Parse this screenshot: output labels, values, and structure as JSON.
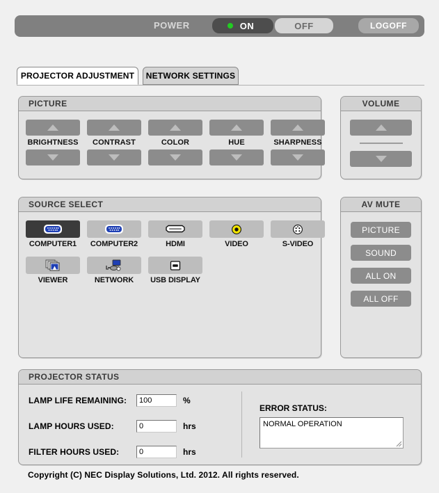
{
  "power": {
    "label": "POWER",
    "on_label": "ON",
    "off_label": "OFF",
    "logoff_label": "LOGOFF",
    "state": "ON",
    "led_color": "#22cc22",
    "on_bg": "#4d4d4d",
    "bar_bg": "#808080"
  },
  "tabs": [
    {
      "label": "PROJECTOR ADJUSTMENT",
      "active": true
    },
    {
      "label": "NETWORK SETTINGS",
      "active": false
    }
  ],
  "picture": {
    "title": "PICTURE",
    "items": [
      {
        "label": "BRIGHTNESS"
      },
      {
        "label": "CONTRAST"
      },
      {
        "label": "COLOR"
      },
      {
        "label": "HUE"
      },
      {
        "label": "SHARPNESS"
      }
    ]
  },
  "volume": {
    "title": "VOLUME"
  },
  "source_select": {
    "title": "SOURCE SELECT",
    "row1": [
      {
        "label": "COMPUTER1",
        "icon": "vga-port-icon",
        "selected": true
      },
      {
        "label": "COMPUTER2",
        "icon": "vga-port-icon",
        "selected": false
      },
      {
        "label": "HDMI",
        "icon": "hdmi-port-icon",
        "selected": false
      },
      {
        "label": "VIDEO",
        "icon": "rca-composite-icon",
        "selected": false
      },
      {
        "label": "S-VIDEO",
        "icon": "svideo-port-icon",
        "selected": false
      }
    ],
    "row2": [
      {
        "label": "VIEWER",
        "icon": "viewer-slides-icon",
        "selected": false
      },
      {
        "label": "NETWORK",
        "icon": "network-computer-icon",
        "selected": false
      },
      {
        "label": "USB DISPLAY",
        "icon": "usb-port-icon",
        "selected": false
      }
    ]
  },
  "av_mute": {
    "title": "AV MUTE",
    "buttons": [
      {
        "label": "PICTURE"
      },
      {
        "label": "SOUND"
      },
      {
        "label": "ALL ON"
      },
      {
        "label": "ALL OFF"
      }
    ]
  },
  "projector_status": {
    "title": "PROJECTOR STATUS",
    "rows": [
      {
        "label": "LAMP LIFE REMAINING:",
        "value": "100",
        "unit": "%"
      },
      {
        "label": "LAMP HOURS USED:",
        "value": "0",
        "unit": "hrs"
      },
      {
        "label": "FILTER HOURS USED:",
        "value": "0",
        "unit": "hrs"
      }
    ],
    "error_status_label": "ERROR STATUS:",
    "error_status_value": "NORMAL OPERATION"
  },
  "copyright": "Copyright (C) NEC Display Solutions, Ltd. 2012. All rights reserved."
}
